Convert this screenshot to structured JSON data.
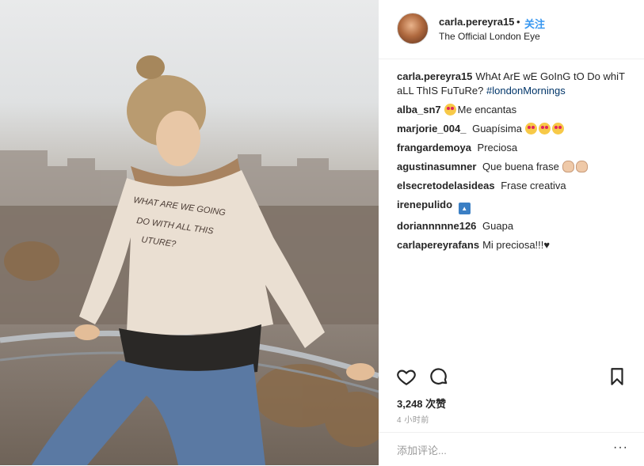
{
  "header": {
    "username": "carla.pereyra15",
    "dot": "•",
    "follow_label": "关注",
    "location": "The Official London Eye"
  },
  "photo": {
    "sweater_line1": "WHAT ARE WE GOING",
    "sweater_line2": "DO WITH ALL THIS",
    "sweater_line3": "UTURE?"
  },
  "comments": [
    {
      "user": "carla.pereyra15",
      "text": "WhAt ArE wE GoInG tO Do whiT aLL ThIS FuTuRe?",
      "hashtag": "#londonMornings"
    },
    {
      "user": "alba_sn7",
      "text": "Me encantas",
      "emoji": "smiling-face-with-heart-eyes"
    },
    {
      "user": "marjorie_004_",
      "text": "Guapísima",
      "emoji": "smiling-face-with-heart-eyes"
    },
    {
      "user": "frangardemoya",
      "text": "Preciosa"
    },
    {
      "user": "agustinasumner",
      "text": "Que buena frase",
      "emoji": "raised-hands"
    },
    {
      "user": "elsecretodelasideas",
      "text": "Frase creativa"
    },
    {
      "user": "irenepulido",
      "emoji": "top-arrow"
    },
    {
      "user": "doriannnnne126",
      "text": "Guapa"
    },
    {
      "user": "carlapereyrafans",
      "text": "Mi preciosa!!!",
      "trailing_glyph": "♥"
    }
  ],
  "actions": {
    "like_icon": "heart-outline-icon",
    "comment_icon": "comment-bubble-icon",
    "save_icon": "bookmark-icon"
  },
  "likes": "3,248 次赞",
  "timestamp": "4 小时前",
  "add_comment": {
    "placeholder": "添加评论...",
    "more_label": "···"
  },
  "colors": {
    "link": "#3897f0",
    "hashtag": "#003569",
    "text": "#262626",
    "muted": "#999999",
    "border": "#efefef"
  }
}
